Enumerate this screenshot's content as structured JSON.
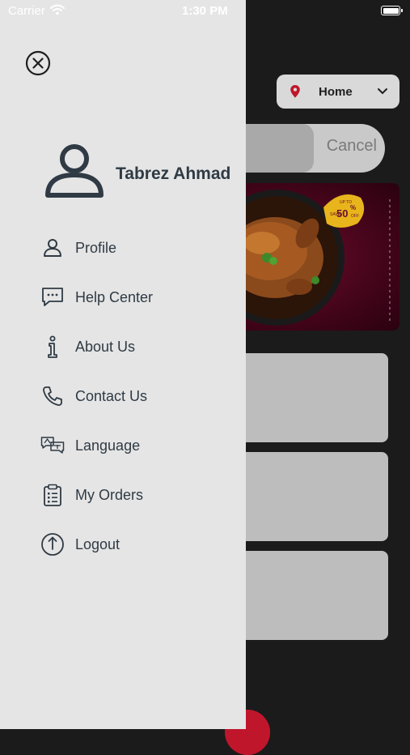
{
  "status_bar": {
    "carrier": "Carrier",
    "time": "1:30 PM"
  },
  "background": {
    "location": {
      "label": "Home",
      "icon": "location-pin-icon",
      "accent": "#c0162b"
    },
    "search": {
      "cancel_label": "Cancel"
    },
    "banner": {
      "badge_top": "UP TO",
      "badge_value": "50",
      "badge_percent": "%",
      "badge_left": "SAVE",
      "badge_bottom": "OFF"
    }
  },
  "drawer": {
    "close_icon": "close-circle-icon",
    "user": {
      "name": "Tabrez Ahmad",
      "icon": "user-avatar-icon"
    },
    "menu": [
      {
        "label": "Profile",
        "icon": "user-icon"
      },
      {
        "label": "Help Center",
        "icon": "chat-bubble-icon"
      },
      {
        "label": "About Us",
        "icon": "info-icon"
      },
      {
        "label": "Contact Us",
        "icon": "phone-icon"
      },
      {
        "label": "Language",
        "icon": "language-icon"
      },
      {
        "label": "My Orders",
        "icon": "clipboard-icon"
      },
      {
        "label": "Logout",
        "icon": "power-icon"
      }
    ]
  },
  "colors": {
    "drawer_bg": "#e5e5e5",
    "text": "#2f3a44",
    "accent": "#c0162b",
    "overlay": "#1b1b1b"
  }
}
